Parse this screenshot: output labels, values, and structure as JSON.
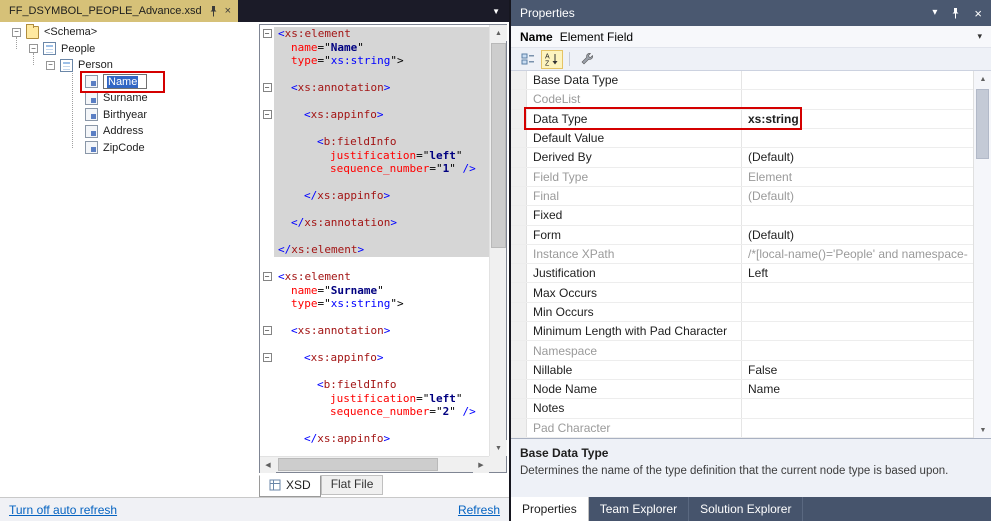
{
  "icons": {
    "close": "×",
    "dropdown": "▼",
    "dropdown_small": "▾",
    "collapse": "−",
    "scroll_up": "▲",
    "scroll_down": "▼",
    "scroll_left": "◀",
    "scroll_right": "▶"
  },
  "colors": {
    "annotation": "#d40000",
    "active_doc_tab": "#d6c178",
    "titlebar": "#4a5870",
    "link": "#0563c1"
  },
  "left": {
    "tab": {
      "title": "FF_DSYMBOL_PEOPLE_Advance.xsd"
    },
    "tree": {
      "items": [
        {
          "id": "schema",
          "label": "<Schema>",
          "level": 0,
          "leaf": false,
          "icon": "schema-folder-icon"
        },
        {
          "id": "people",
          "label": "People",
          "level": 1,
          "leaf": false,
          "icon": "record-icon"
        },
        {
          "id": "person",
          "label": "Person",
          "level": 2,
          "leaf": false,
          "icon": "record-icon"
        },
        {
          "id": "name",
          "label": "Name",
          "level": 3,
          "leaf": true,
          "icon": "field-icon",
          "editing": true,
          "annotated": true
        },
        {
          "id": "surname",
          "label": "Surname",
          "level": 3,
          "leaf": true,
          "icon": "field-icon"
        },
        {
          "id": "birthyear",
          "label": "Birthyear",
          "level": 3,
          "leaf": true,
          "icon": "field-icon"
        },
        {
          "id": "address",
          "label": "Address",
          "level": 3,
          "leaf": true,
          "icon": "field-icon"
        },
        {
          "id": "zipcode",
          "label": "ZipCode",
          "level": 3,
          "leaf": true,
          "icon": "field-icon"
        }
      ]
    },
    "code": {
      "lines": [
        {
          "h": 1,
          "f": 1,
          "i": 0,
          "t": [
            [
              "d",
              "<"
            ],
            [
              "t",
              "xs:element"
            ]
          ]
        },
        {
          "h": 1,
          "i": 1,
          "t": [
            [
              "a",
              "name"
            ],
            [
              "p",
              "=\""
            ],
            [
              "vb",
              "Name"
            ],
            [
              "p",
              "\""
            ]
          ]
        },
        {
          "h": 1,
          "i": 1,
          "t": [
            [
              "a",
              "type"
            ],
            [
              "p",
              "=\""
            ],
            [
              "v",
              "xs:string"
            ],
            [
              "p",
              "\">"
            ]
          ]
        },
        {
          "h": 1,
          "t": []
        },
        {
          "h": 1,
          "f": 1,
          "i": 1,
          "t": [
            [
              "d",
              "<"
            ],
            [
              "t",
              "xs:annotation"
            ],
            [
              "d",
              ">"
            ]
          ]
        },
        {
          "h": 1,
          "t": []
        },
        {
          "h": 1,
          "f": 1,
          "i": 2,
          "t": [
            [
              "d",
              "<"
            ],
            [
              "t",
              "xs:appinfo"
            ],
            [
              "d",
              ">"
            ]
          ]
        },
        {
          "h": 1,
          "t": []
        },
        {
          "h": 1,
          "i": 3,
          "t": [
            [
              "d",
              "<"
            ],
            [
              "t",
              "b:fieldInfo"
            ]
          ]
        },
        {
          "h": 1,
          "i": 4,
          "t": [
            [
              "a",
              "justification"
            ],
            [
              "p",
              "=\""
            ],
            [
              "vb",
              "left"
            ],
            [
              "p",
              "\""
            ]
          ]
        },
        {
          "h": 1,
          "i": 4,
          "t": [
            [
              "a",
              "sequence_number"
            ],
            [
              "p",
              "=\""
            ],
            [
              "vb",
              "1"
            ],
            [
              "p",
              "\" "
            ],
            [
              "d",
              "/>"
            ]
          ]
        },
        {
          "h": 1,
          "t": []
        },
        {
          "h": 1,
          "i": 2,
          "t": [
            [
              "d",
              "</"
            ],
            [
              "t",
              "xs:appinfo"
            ],
            [
              "d",
              ">"
            ]
          ]
        },
        {
          "h": 1,
          "t": []
        },
        {
          "h": 1,
          "i": 1,
          "t": [
            [
              "d",
              "</"
            ],
            [
              "t",
              "xs:annotation"
            ],
            [
              "d",
              ">"
            ]
          ]
        },
        {
          "h": 1,
          "t": []
        },
        {
          "h": 1,
          "i": 0,
          "t": [
            [
              "d",
              "</"
            ],
            [
              "t",
              "xs:element"
            ],
            [
              "d",
              ">"
            ]
          ]
        },
        {
          "t": []
        },
        {
          "f": 1,
          "i": 0,
          "t": [
            [
              "d",
              "<"
            ],
            [
              "t",
              "xs:element"
            ]
          ]
        },
        {
          "i": 1,
          "t": [
            [
              "a",
              "name"
            ],
            [
              "p",
              "=\""
            ],
            [
              "vb",
              "Surname"
            ],
            [
              "p",
              "\""
            ]
          ]
        },
        {
          "i": 1,
          "t": [
            [
              "a",
              "type"
            ],
            [
              "p",
              "=\""
            ],
            [
              "v",
              "xs:string"
            ],
            [
              "p",
              "\">"
            ]
          ]
        },
        {
          "t": []
        },
        {
          "f": 1,
          "i": 1,
          "t": [
            [
              "d",
              "<"
            ],
            [
              "t",
              "xs:annotation"
            ],
            [
              "d",
              ">"
            ]
          ]
        },
        {
          "t": []
        },
        {
          "f": 1,
          "i": 2,
          "t": [
            [
              "d",
              "<"
            ],
            [
              "t",
              "xs:appinfo"
            ],
            [
              "d",
              ">"
            ]
          ]
        },
        {
          "t": []
        },
        {
          "i": 3,
          "t": [
            [
              "d",
              "<"
            ],
            [
              "t",
              "b:fieldInfo"
            ]
          ]
        },
        {
          "i": 4,
          "t": [
            [
              "a",
              "justification"
            ],
            [
              "p",
              "=\""
            ],
            [
              "vb",
              "left"
            ],
            [
              "p",
              "\""
            ]
          ]
        },
        {
          "i": 4,
          "t": [
            [
              "a",
              "sequence_number"
            ],
            [
              "p",
              "=\""
            ],
            [
              "vb",
              "2"
            ],
            [
              "p",
              "\" "
            ],
            [
              "d",
              "/>"
            ]
          ]
        },
        {
          "t": []
        },
        {
          "i": 2,
          "t": [
            [
              "d",
              "</"
            ],
            [
              "t",
              "xs:appinfo"
            ],
            [
              "d",
              ">"
            ]
          ]
        }
      ]
    },
    "view_tabs": [
      {
        "label": "XSD",
        "active": true
      },
      {
        "label": "Flat File",
        "active": false
      }
    ],
    "footer": {
      "autorefresh": "Turn off auto refresh",
      "refresh": "Refresh"
    }
  },
  "props": {
    "title": "Properties",
    "object_name": "Name",
    "object_type": "Element Field",
    "toolbar": [
      {
        "id": "categorized-icon",
        "pressed": false
      },
      {
        "id": "sort-alphabetical-icon",
        "pressed": true
      },
      {
        "id": "property-pages-icon",
        "pressed": false
      }
    ],
    "rows": [
      {
        "name": "Base Data Type",
        "value": ""
      },
      {
        "name": "CodeList",
        "value": "",
        "disabled": true
      },
      {
        "name": "Data Type",
        "value": "xs:string",
        "bold": true,
        "annotated": true
      },
      {
        "name": "Default Value",
        "value": ""
      },
      {
        "name": "Derived By",
        "value": "(Default)"
      },
      {
        "name": "Field Type",
        "value": "Element",
        "disabled": true
      },
      {
        "name": "Final",
        "value": "(Default)",
        "disabled": true
      },
      {
        "name": "Fixed",
        "value": ""
      },
      {
        "name": "Form",
        "value": "(Default)"
      },
      {
        "name": "Instance XPath",
        "value": "/*[local-name()='People' and namespace-",
        "disabled": true
      },
      {
        "name": "Justification",
        "value": "Left"
      },
      {
        "name": "Max Occurs",
        "value": ""
      },
      {
        "name": "Min Occurs",
        "value": ""
      },
      {
        "name": "Minimum Length with Pad Character",
        "value": ""
      },
      {
        "name": "Namespace",
        "value": "",
        "disabled": true
      },
      {
        "name": "Nillable",
        "value": "False"
      },
      {
        "name": "Node Name",
        "value": "Name"
      },
      {
        "name": "Notes",
        "value": ""
      },
      {
        "name": "Pad Character",
        "value": "",
        "disabled": true
      }
    ],
    "description": {
      "title": "Base Data Type",
      "text": "Determines the name of the type definition that the current node type is based upon."
    },
    "bottom_tabs": [
      {
        "label": "Properties",
        "active": true
      },
      {
        "label": "Team Explorer",
        "active": false
      },
      {
        "label": "Solution Explorer",
        "active": false
      }
    ]
  }
}
